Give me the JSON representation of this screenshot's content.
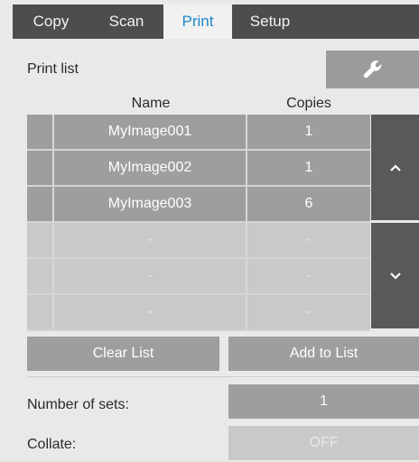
{
  "tabs": [
    {
      "label": "Copy",
      "active": false
    },
    {
      "label": "Scan",
      "active": false
    },
    {
      "label": "Print",
      "active": true
    },
    {
      "label": "Setup",
      "active": false
    }
  ],
  "print_list": {
    "label": "Print list",
    "tool_icon": "wrench-icon",
    "columns": {
      "name": "Name",
      "copies": "Copies"
    },
    "rows": [
      {
        "name": "MyImage001",
        "copies": "1"
      },
      {
        "name": "MyImage002",
        "copies": "1"
      },
      {
        "name": "MyImage003",
        "copies": "6"
      },
      {
        "name": "-",
        "copies": "-"
      },
      {
        "name": "-",
        "copies": "-"
      },
      {
        "name": "-",
        "copies": "-"
      }
    ],
    "scroll_up_icon": "chevron-up-icon",
    "scroll_down_icon": "chevron-down-icon"
  },
  "actions": {
    "clear_list": "Clear List",
    "add_to_list": "Add to List"
  },
  "settings": {
    "sets_label": "Number of sets:",
    "sets_value": "1",
    "collate_label": "Collate:",
    "collate_value": "OFF"
  },
  "colors": {
    "tab_bar": "#4d4d4d",
    "active_tab_text": "#1e88c9",
    "row_filled": "#9e9e9e",
    "row_empty": "#c9c9c9",
    "scroll_button": "#595959"
  }
}
